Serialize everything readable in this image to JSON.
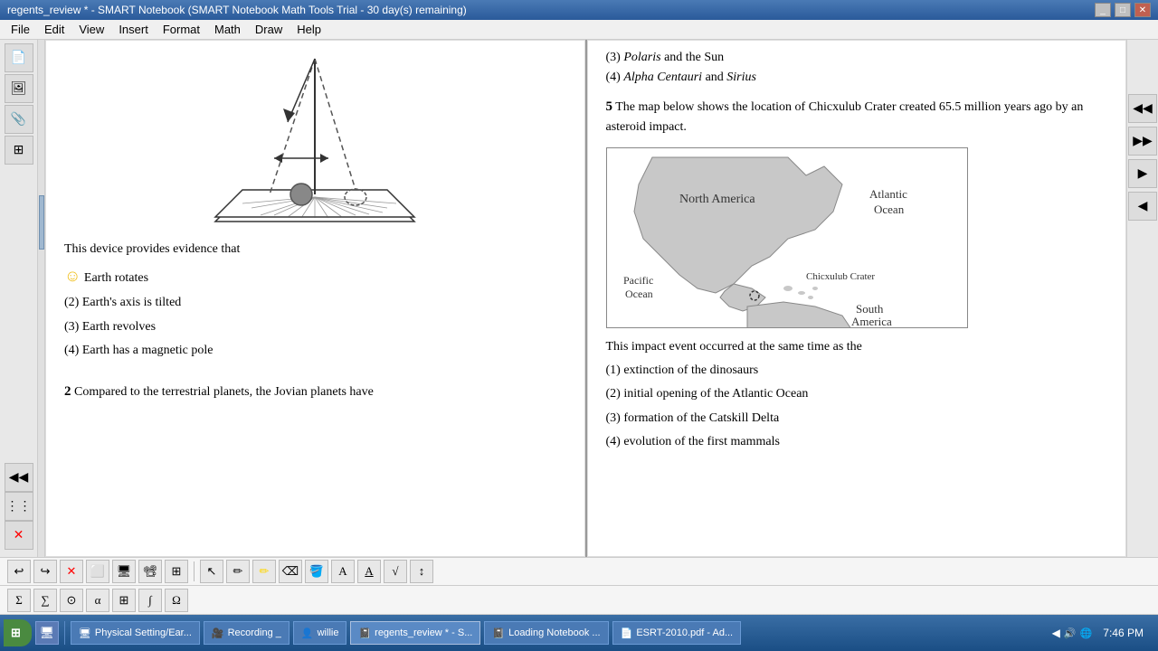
{
  "titlebar": {
    "title": "regents_review * - SMART Notebook (SMART Notebook Math Tools Trial - 30 day(s) remaining)",
    "controls": [
      "_",
      "□",
      "✕"
    ]
  },
  "menubar": {
    "items": [
      "File",
      "Edit",
      "View",
      "Insert",
      "Format",
      "Math",
      "Draw",
      "Help"
    ]
  },
  "left_page": {
    "device_text": "This device provides evidence that",
    "choices": [
      {
        "num": "☺",
        "text": "Earth rotates"
      },
      {
        "num": "(2)",
        "text": "Earth's axis is tilted"
      },
      {
        "num": "(3)",
        "text": "Earth revolves"
      },
      {
        "num": "(4)",
        "text": "Earth has a magnetic pole"
      }
    ],
    "question2_num": "2",
    "question2_text": "Compared to the terrestrial planets, the Jovian planets have"
  },
  "right_page": {
    "prev_items": [
      {
        "text": "(3) Polaris and the Sun"
      },
      {
        "text": "(4) Alpha Centauri and Sirius"
      }
    ],
    "question5_num": "5",
    "question5_text": "The map below shows the location of Chicxulub Crater created 65.5 million years ago by an asteroid impact.",
    "map_labels": {
      "north_america": "North America",
      "atlantic_ocean": "Atlantic Ocean",
      "chicxulub": "Chicxulub Crater",
      "pacific_ocean": "Pacific Ocean",
      "south_america": "South America"
    },
    "impact_text": "This impact event occurred at the same time as the",
    "impact_choices": [
      {
        "num": "(1)",
        "text": "extinction of the dinosaurs"
      },
      {
        "num": "(2)",
        "text": "initial opening of the Atlantic Ocean"
      },
      {
        "num": "(3)",
        "text": "formation of the Catskill Delta"
      },
      {
        "num": "(4)",
        "text": "evolution of the first mammals"
      }
    ]
  },
  "toolbar_bottom": {
    "formula_btn": "Σ"
  },
  "taskbar": {
    "start_label": "Start",
    "time": "7:46 PM",
    "tasks": [
      {
        "label": "Physical Setting/Ear...",
        "icon": "🖥"
      },
      {
        "label": "Recording _",
        "icon": "🎥",
        "active": false
      },
      {
        "label": "willie",
        "icon": "👤"
      },
      {
        "label": "regents_review * - S...",
        "icon": "📓",
        "active": true
      },
      {
        "label": "Loading Notebook ...",
        "icon": "📓"
      },
      {
        "label": "ESRT-2010.pdf - Ad...",
        "icon": "📄"
      }
    ]
  },
  "recording_text": "Recording _"
}
